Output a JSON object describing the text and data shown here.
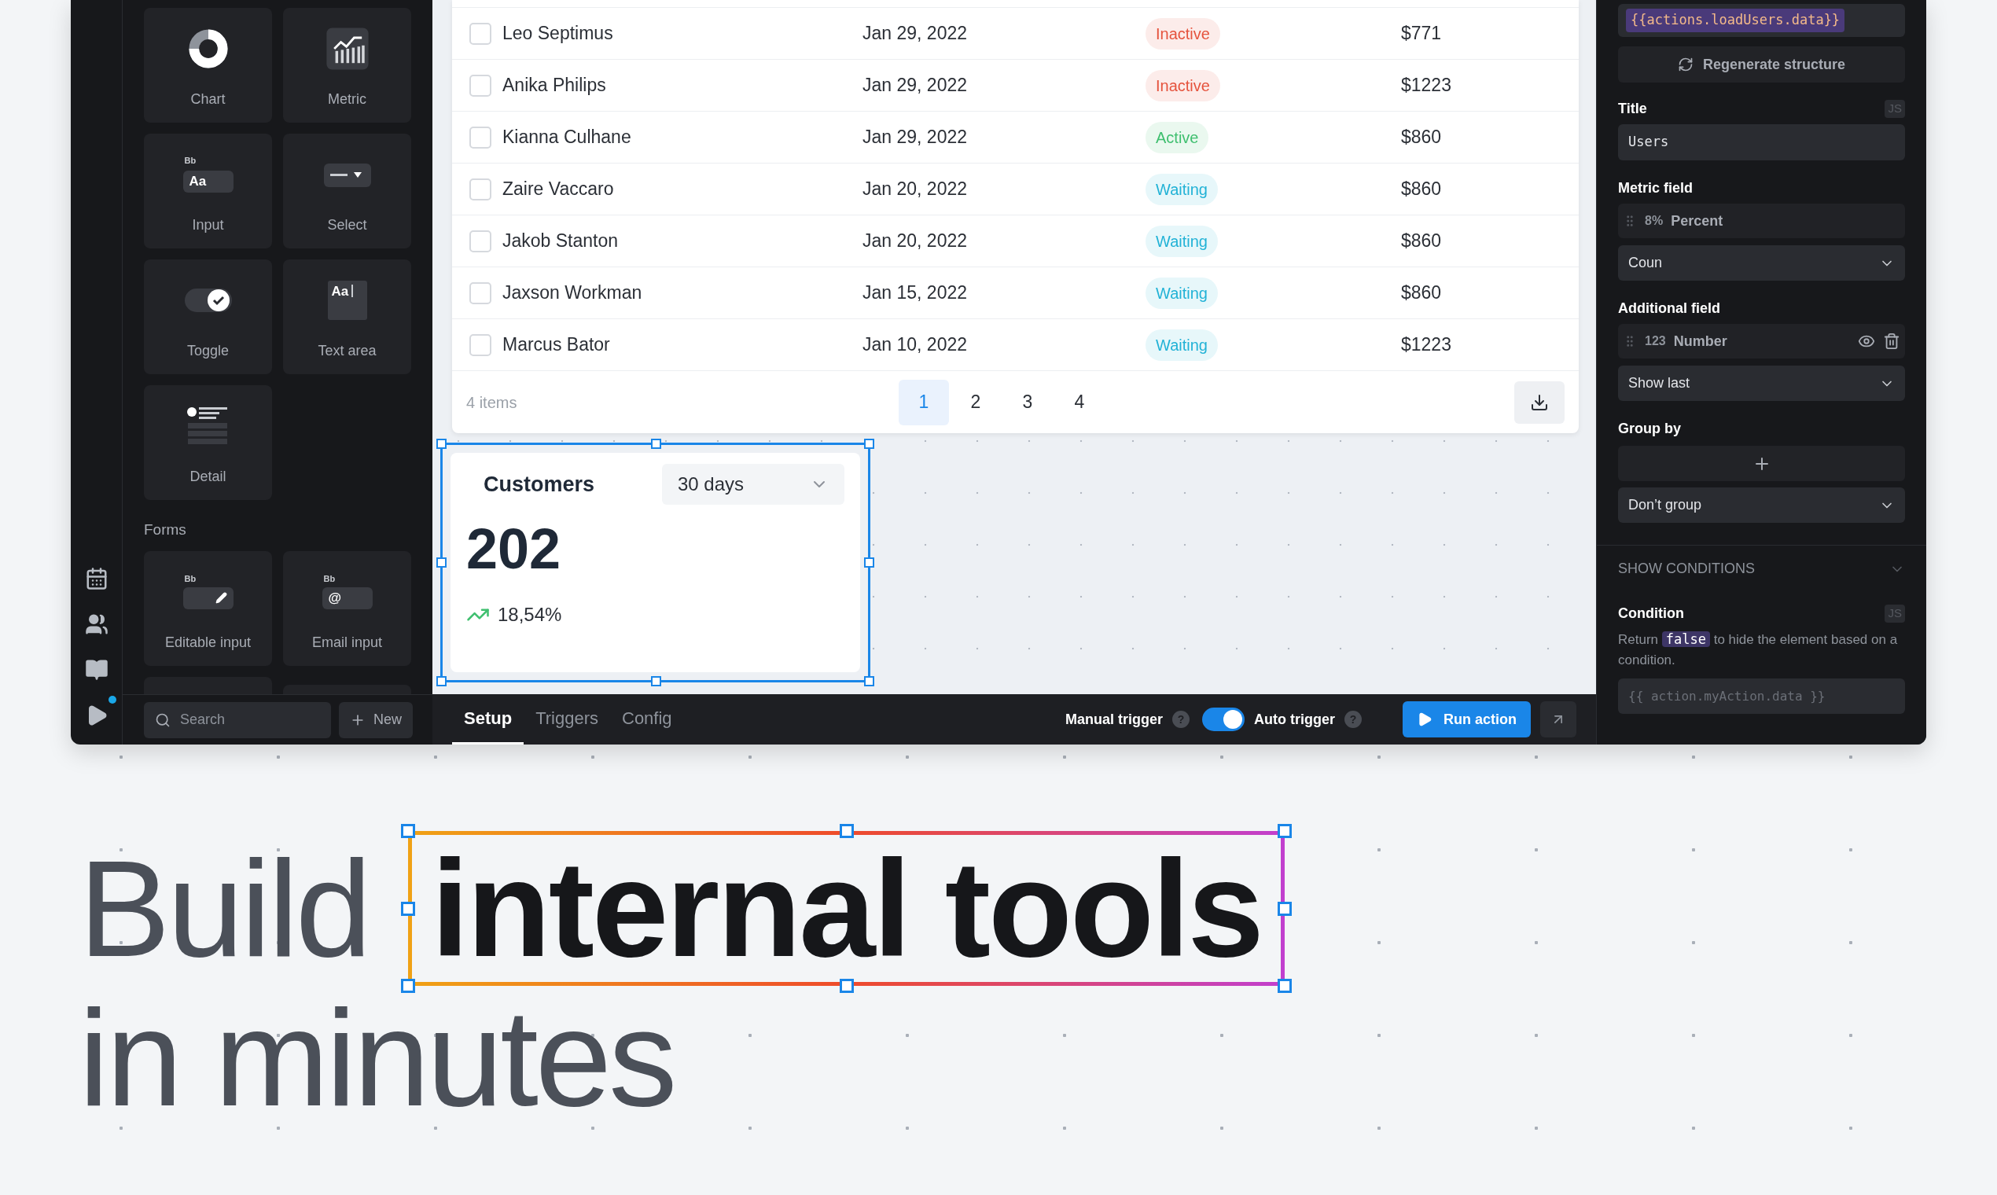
{
  "components_panel": {
    "items": [
      {
        "label": "Chart",
        "kind": "chart"
      },
      {
        "label": "Metric",
        "kind": "metric"
      },
      {
        "label": "Input",
        "kind": "input"
      },
      {
        "label": "Select",
        "kind": "select"
      },
      {
        "label": "Toggle",
        "kind": "toggle"
      },
      {
        "label": "Text area",
        "kind": "textarea"
      },
      {
        "label": "Detail",
        "kind": "detail"
      }
    ],
    "section": {
      "title": "Forms",
      "items": [
        {
          "label": "Editable input",
          "kind": "editable"
        },
        {
          "label": "Email input",
          "kind": "email"
        }
      ]
    },
    "icon_texts": {
      "input": [
        "Bb",
        "Aa"
      ],
      "textarea": [
        "Aa"
      ],
      "editable": [
        "Bb"
      ],
      "email": [
        "Bb",
        "@"
      ]
    },
    "search": {
      "placeholder": "Search"
    },
    "new_button": "New"
  },
  "table": {
    "rows": [
      {
        "name": "Leo Septimus",
        "date": "Jan 29, 2022",
        "status": "Inactive",
        "color": "#e5533d",
        "amount": "$771",
        "checked": false
      },
      {
        "name": "Anika Philips",
        "date": "Jan 29, 2022",
        "status": "Inactive",
        "color": "#e5533d",
        "amount": "$1223",
        "checked": false
      },
      {
        "name": "Kianna Culhane",
        "date": "Jan 29, 2022",
        "status": "Active",
        "color": "#3fbf6f",
        "amount": "$860",
        "checked": false
      },
      {
        "name": "Zaire Vaccaro",
        "date": "Jan 20, 2022",
        "status": "Waiting",
        "color": "#22b2d6",
        "amount": "$860",
        "checked": false
      },
      {
        "name": "Jakob Stanton",
        "date": "Jan 20, 2022",
        "status": "Waiting",
        "color": "#22b2d6",
        "amount": "$860",
        "checked": false
      },
      {
        "name": "Jaxson Workman",
        "date": "Jan 15, 2022",
        "status": "Waiting",
        "color": "#22b2d6",
        "amount": "$860",
        "checked": false
      },
      {
        "name": "Marcus Bator",
        "date": "Jan 10, 2022",
        "status": "Waiting",
        "color": "#22b2d6",
        "amount": "$1223",
        "checked": false
      }
    ],
    "item_count": "4 items",
    "pages": [
      {
        "label": "1",
        "selected": true
      },
      {
        "label": "2",
        "selected": false
      },
      {
        "label": "3",
        "selected": false
      },
      {
        "label": "4",
        "selected": false
      }
    ]
  },
  "metric_card": {
    "title": "Customers",
    "period": "30 days",
    "value": "202",
    "change": "18,54%",
    "selected": true
  },
  "bottom_bar": {
    "tabs": [
      {
        "label": "Setup",
        "selected": true
      },
      {
        "label": "Triggers",
        "selected": false
      },
      {
        "label": "Config",
        "selected": false
      }
    ],
    "manual_trigger": {
      "label": "Manual trigger",
      "help": "?"
    },
    "auto_trigger": {
      "label": "Auto trigger",
      "help": "?",
      "on": true
    },
    "run_button": "Run action"
  },
  "properties": {
    "data_source": "{{actions.loadUsers.data}}",
    "regenerate_button": "Regenerate structure",
    "title": {
      "label": "Title",
      "badge": "JS",
      "value": "Users"
    },
    "metric_field": {
      "label": "Metric field",
      "type_badge": "8%",
      "field": "Percent",
      "aggregation": "Coun"
    },
    "additional_field": {
      "label": "Additional field",
      "type_badge": "123",
      "field": "Number",
      "mode": "Show last"
    },
    "group_by": {
      "label": "Group by",
      "value": "Don’t group"
    },
    "show_conditions": {
      "label": "SHOW CONDITIONS"
    },
    "condition": {
      "label": "Condition",
      "badge": "JS",
      "hint": "Return **false** to hide the element based on a condition.",
      "placeholder": "{{ action.myAction.data }}"
    }
  },
  "headline": {
    "start": "Build",
    "highlight": "internal tools",
    "line_2": "in minutes"
  }
}
